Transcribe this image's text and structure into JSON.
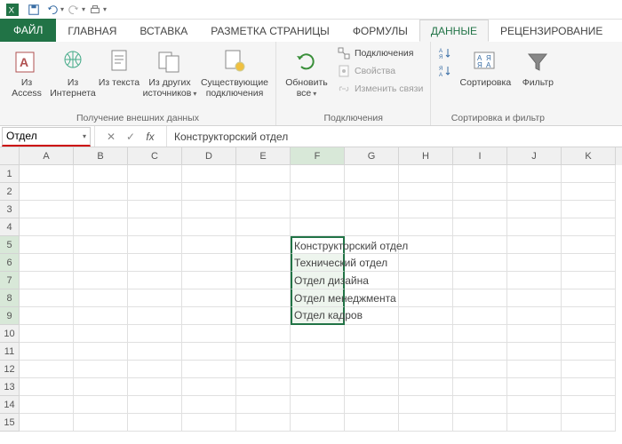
{
  "qat": {
    "save": "save",
    "undo": "undo",
    "redo": "redo",
    "quickprint": "quickprint"
  },
  "tabs": {
    "file": "ФАЙЛ",
    "home": "ГЛАВНАЯ",
    "insert": "ВСТАВКА",
    "pagelayout": "РАЗМЕТКА СТРАНИЦЫ",
    "formulas": "ФОРМУЛЫ",
    "data": "ДАННЫЕ",
    "review": "РЕЦЕНЗИРОВАНИЕ"
  },
  "ribbon": {
    "ext": {
      "access": "Из Access",
      "web": "Из Интернета",
      "text": "Из текста",
      "other": "Из других источников",
      "existing": "Существующие подключения",
      "group": "Получение внешних данных"
    },
    "conn": {
      "refresh": "Обновить все",
      "connections": "Подключения",
      "properties": "Свойства",
      "editlinks": "Изменить связи",
      "group": "Подключения"
    },
    "sort": {
      "az": "А↓Я",
      "za": "Я↓А",
      "sort": "Сортировка",
      "filter": "Фильтр",
      "group": "Сортировка и фильтр"
    }
  },
  "namebox": {
    "value": "Отдел"
  },
  "formula": {
    "value": "Конструкторский отдел"
  },
  "columns": [
    "A",
    "B",
    "C",
    "D",
    "E",
    "F",
    "G",
    "H",
    "I",
    "J",
    "K"
  ],
  "rows": [
    1,
    2,
    3,
    4,
    5,
    6,
    7,
    8,
    9,
    10,
    11,
    12,
    13,
    14,
    15
  ],
  "cells": {
    "F5": "Конструкторский отдел",
    "F6": "Технический отдел",
    "F7": "Отдел дизайна",
    "F8": "Отдел менеджмента",
    "F9": "Отдел кадров"
  },
  "selection": {
    "col": "F",
    "rows": [
      5,
      6,
      7,
      8,
      9
    ],
    "active": "F5"
  }
}
